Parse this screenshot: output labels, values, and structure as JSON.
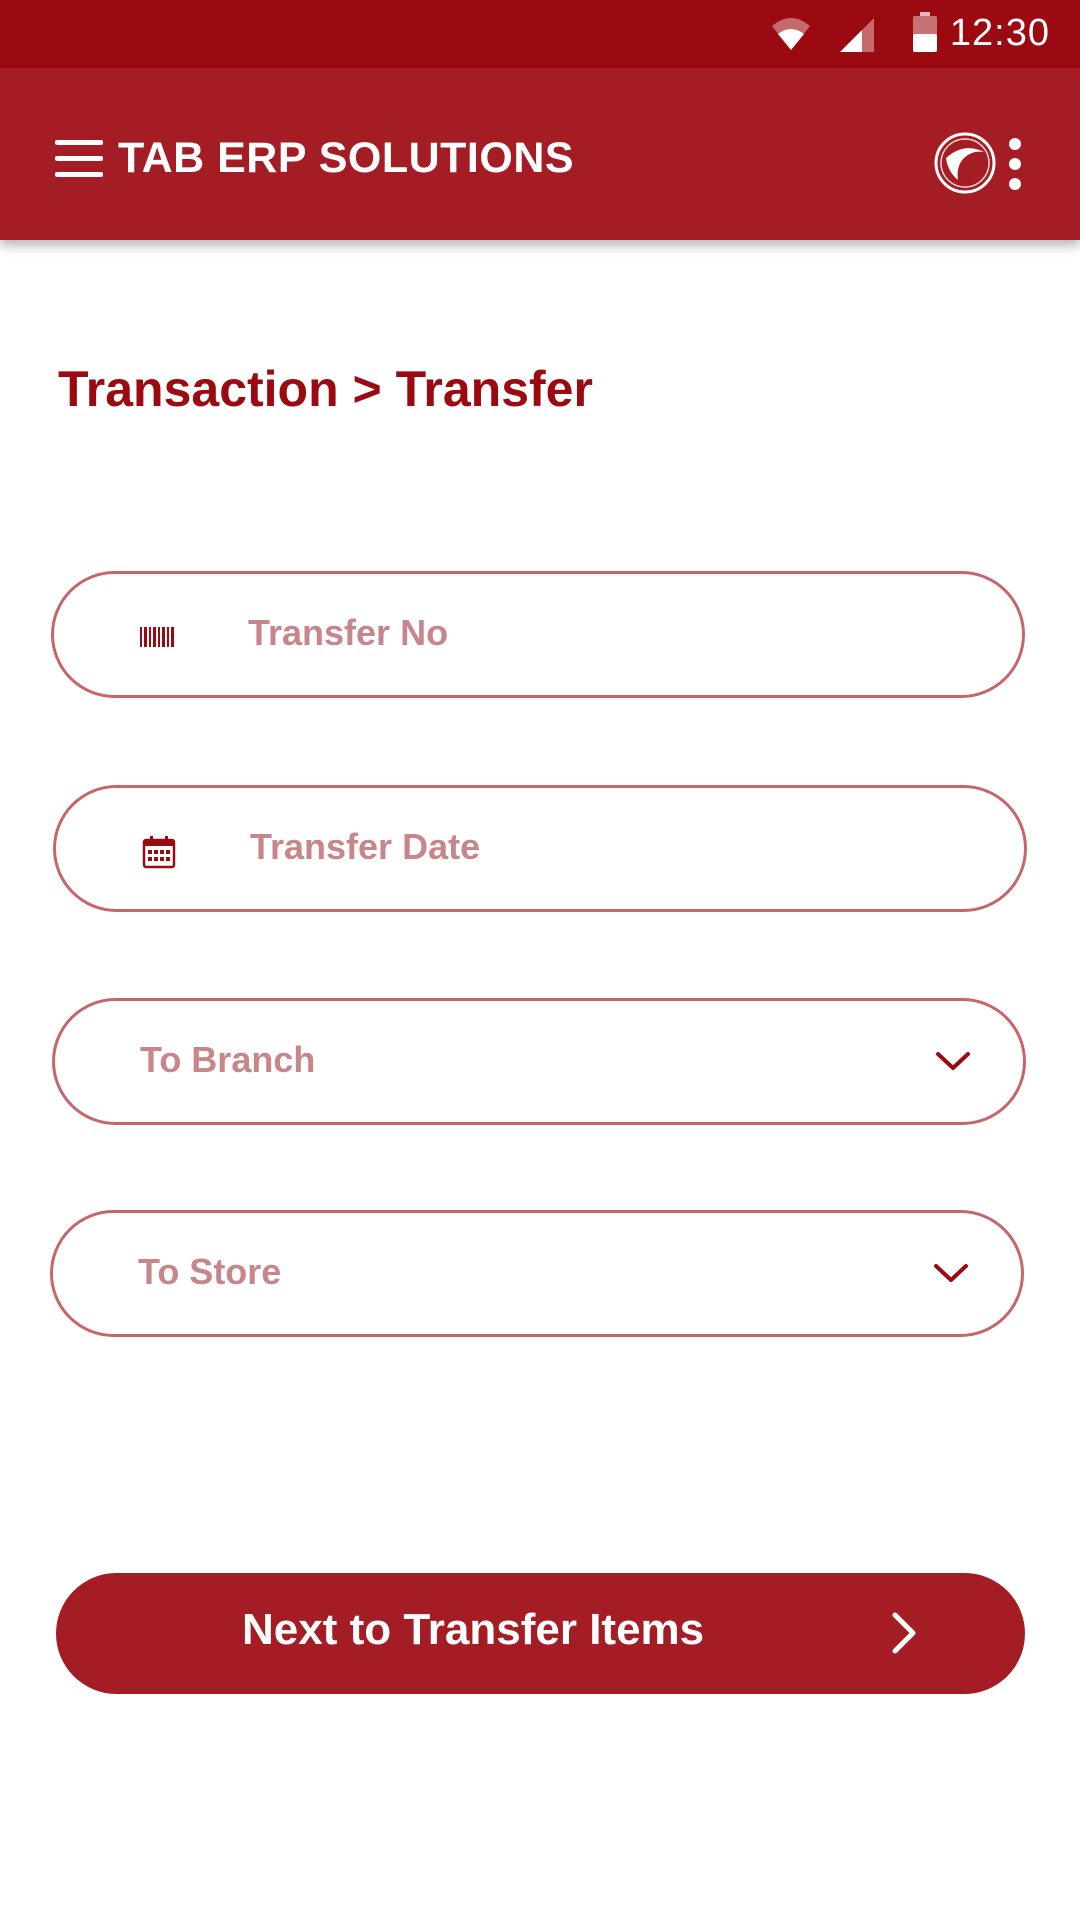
{
  "status_bar": {
    "time": "12:30",
    "icons": [
      "wifi-icon",
      "cell-signal-icon",
      "battery-icon"
    ]
  },
  "app_bar": {
    "title": "TAB ERP SOLUTIONS",
    "icons": [
      "menu-icon",
      "app-logo-icon",
      "overflow-menu-icon"
    ]
  },
  "breadcrumb": "Transaction > Transfer",
  "form": {
    "transfer_no": {
      "placeholder": "Transfer No",
      "icon": "barcode-icon"
    },
    "transfer_date": {
      "placeholder": "Transfer Date",
      "icon": "calendar-icon"
    },
    "to_branch": {
      "placeholder": "To Branch",
      "icon": "chevron-down-icon"
    },
    "to_store": {
      "placeholder": "To Store",
      "icon": "chevron-down-icon"
    }
  },
  "next_button": {
    "label": "Next to Transfer Items",
    "icon": "chevron-right-icon"
  },
  "colors": {
    "status_bar": "#9b0a10",
    "primary": "#a51d24",
    "field_border": "#c7666a",
    "placeholder": "#c7868a",
    "heading": "#9b0a10"
  }
}
